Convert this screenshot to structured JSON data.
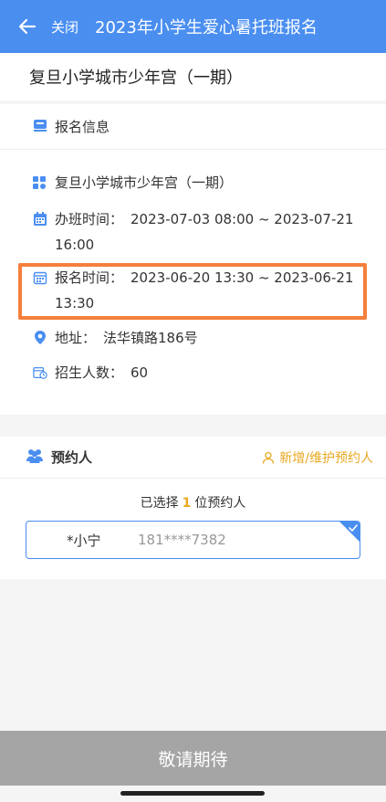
{
  "header": {
    "close_label": "关闭",
    "title": "2023年小学生爱心暑托班报名"
  },
  "page": {
    "title": "复旦小学城市少年宫（一期）"
  },
  "info": {
    "section_label": "报名信息",
    "site_name": "复旦小学城市少年宫（一期）",
    "class_time_key": "办班时间：",
    "class_time_value": "2023-07-03 08:00 ~ 2023-07-21 16:00",
    "signup_time_key": "报名时间：",
    "signup_time_value": "2023-06-20 13:30 ~ 2023-06-21 13:30",
    "address_key": "地址：",
    "address_value": "法华镇路186号",
    "quota_key": "招生人数：",
    "quota_value": "60"
  },
  "booker": {
    "title": "预约人",
    "manage_label": "新增/维护预约人",
    "selected_prefix": "已选择",
    "selected_count": "1",
    "selected_suffix": "位预约人",
    "person_name": "*小宁",
    "person_phone": "181****7382"
  },
  "footer": {
    "button_label": "敬请期待"
  },
  "colors": {
    "header_bg": "#4a8ef0",
    "accent_orange": "#e8a822",
    "highlight": "#f57f3c",
    "disabled_button": "#a5a5a5"
  }
}
